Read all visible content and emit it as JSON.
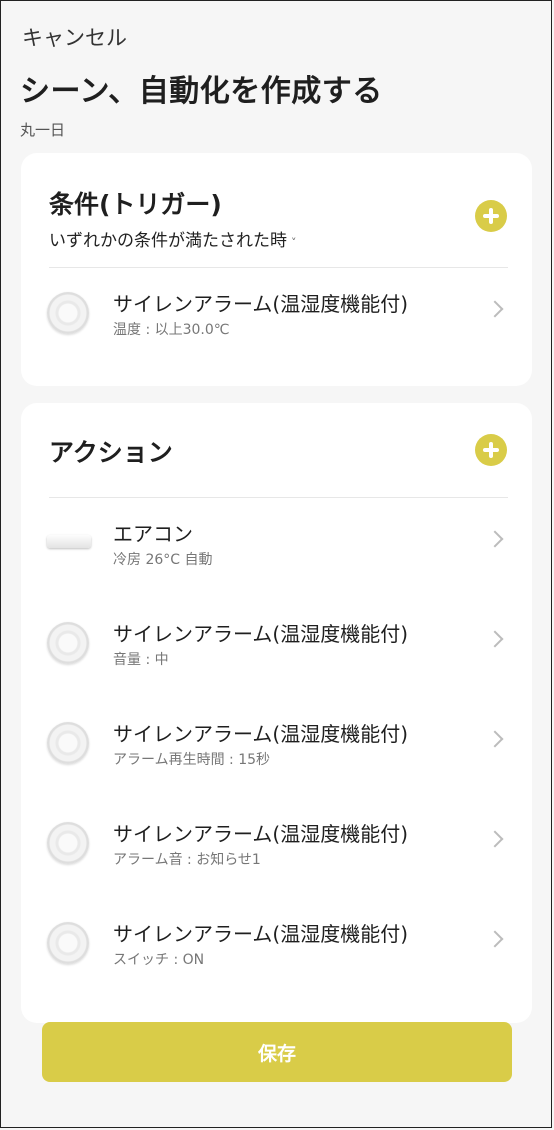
{
  "header": {
    "cancel_label": "キャンセル",
    "title": "シーン、自動化を作成する",
    "subtitle": "丸一日"
  },
  "condition": {
    "title": "条件(トリガー)",
    "mode_label": "いずれかの条件が満たされた時",
    "items": [
      {
        "name": "サイレンアラーム(温湿度機能付)",
        "detail": "温度 : 以上30.0℃",
        "icon": "siren-icon"
      }
    ]
  },
  "action": {
    "title": "アクション",
    "items": [
      {
        "name": "エアコン",
        "detail": "冷房 26°C 自動",
        "icon": "air-conditioner-icon"
      },
      {
        "name": "サイレンアラーム(温湿度機能付)",
        "detail": "音量 : 中",
        "icon": "siren-icon"
      },
      {
        "name": "サイレンアラーム(温湿度機能付)",
        "detail": "アラーム再生時間 : 15秒",
        "icon": "siren-icon"
      },
      {
        "name": "サイレンアラーム(温湿度機能付)",
        "detail": "アラーム音 : お知らせ1",
        "icon": "siren-icon"
      },
      {
        "name": "サイレンアラーム(温湿度機能付)",
        "detail": "スイッチ : ON",
        "icon": "siren-icon"
      }
    ]
  },
  "footer": {
    "save_label": "保存"
  },
  "colors": {
    "accent": "#d9cc48",
    "background": "#f6f6f6",
    "card": "#ffffff"
  }
}
